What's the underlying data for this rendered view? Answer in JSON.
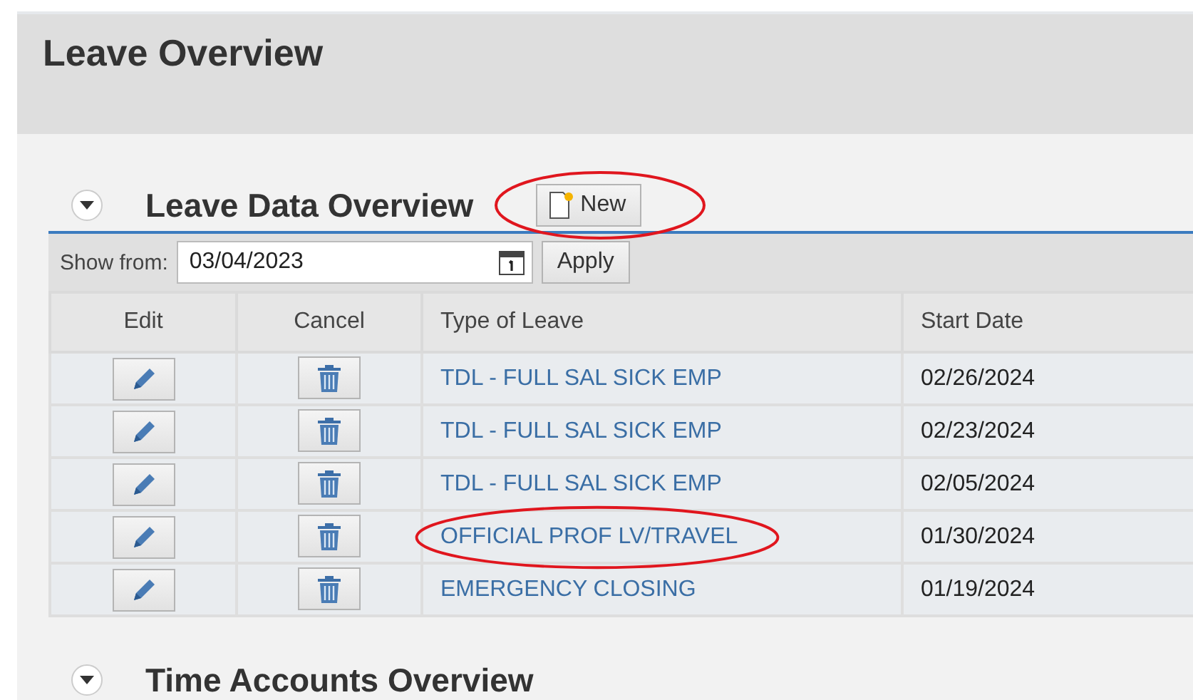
{
  "page_title": "Leave Overview",
  "leave_section": {
    "title": "Leave Data Overview",
    "expanded": true,
    "new_button": {
      "label": "New",
      "circled": true
    },
    "filter": {
      "label": "Show from:",
      "value": "03/04/2023",
      "apply_label": "Apply"
    },
    "table": {
      "columns": [
        "Edit",
        "Cancel",
        "Type of Leave",
        "Start Date"
      ],
      "rows": [
        {
          "type_of_leave": "TDL - FULL SAL SICK EMP",
          "start_date": "02/26/2024",
          "circled": false
        },
        {
          "type_of_leave": "TDL - FULL SAL SICK EMP",
          "start_date": "02/23/2024",
          "circled": false
        },
        {
          "type_of_leave": "TDL - FULL SAL SICK EMP",
          "start_date": "02/05/2024",
          "circled": false
        },
        {
          "type_of_leave": "OFFICIAL PROF LV/TRAVEL",
          "start_date": "01/30/2024",
          "circled": true
        },
        {
          "type_of_leave": "EMERGENCY CLOSING",
          "start_date": "01/19/2024",
          "circled": false
        }
      ]
    }
  },
  "time_section": {
    "title": "Time Accounts Overview",
    "expanded": true
  }
}
